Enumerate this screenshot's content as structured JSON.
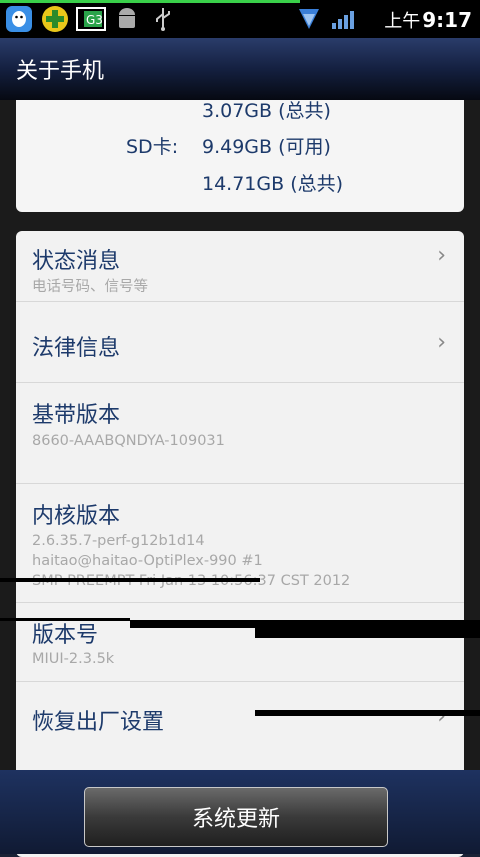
{
  "status_bar": {
    "time_period": "上午",
    "time": "9:17",
    "icons": [
      "qq-icon",
      "add-app-icon",
      "g3-icon",
      "android-icon",
      "usb-icon",
      "wifi-icon",
      "signal-icon"
    ]
  },
  "header": {
    "title": "关于手机"
  },
  "storage": {
    "line1": "3.07GB (总共)",
    "sd_label": "SD卡:",
    "sd_available": "9.49GB (可用)",
    "sd_total": "14.71GB (总共)"
  },
  "items": [
    {
      "label": "状态消息",
      "sub": "电话号码、信号等"
    },
    {
      "label": "法律信息"
    },
    {
      "label": "基带版本",
      "sub": "8660-AAABQNDYA-109031"
    },
    {
      "label": "内核版本",
      "sub1": "2.6.35.7-perf-g12b1d14",
      "sub2": "haitao@haitao-OptiPlex-990 #1",
      "sub3": "SMP PREEMPT Fri Jan 13 10:56:37 CST 2012"
    },
    {
      "label": "版本号",
      "sub": "MIUI-2.3.5k"
    },
    {
      "label": "恢复出厂设置"
    }
  ],
  "footer": {
    "update_button": "系统更新"
  },
  "colors": {
    "accent": "#1d3a6b",
    "statusbar_bg": "#000000",
    "card_bg": "#f2f2f2"
  }
}
